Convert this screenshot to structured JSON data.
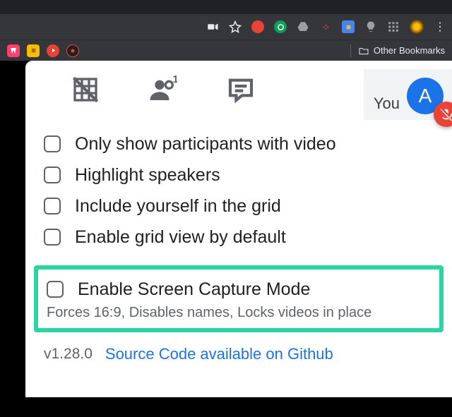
{
  "browser": {
    "other_bookmarks_label": "Other Bookmarks"
  },
  "meet": {
    "you_label": "You",
    "avatar_letter": "A"
  },
  "options": [
    {
      "label": "Only show participants with video"
    },
    {
      "label": "Highlight speakers"
    },
    {
      "label": "Include yourself in the grid"
    },
    {
      "label": "Enable grid view by default"
    }
  ],
  "highlight": {
    "label": "Enable Screen Capture Mode",
    "desc": "Forces 16:9, Disables names, Locks videos in place"
  },
  "footer": {
    "version": "v1.28.0",
    "link": "Source Code available on Github"
  }
}
